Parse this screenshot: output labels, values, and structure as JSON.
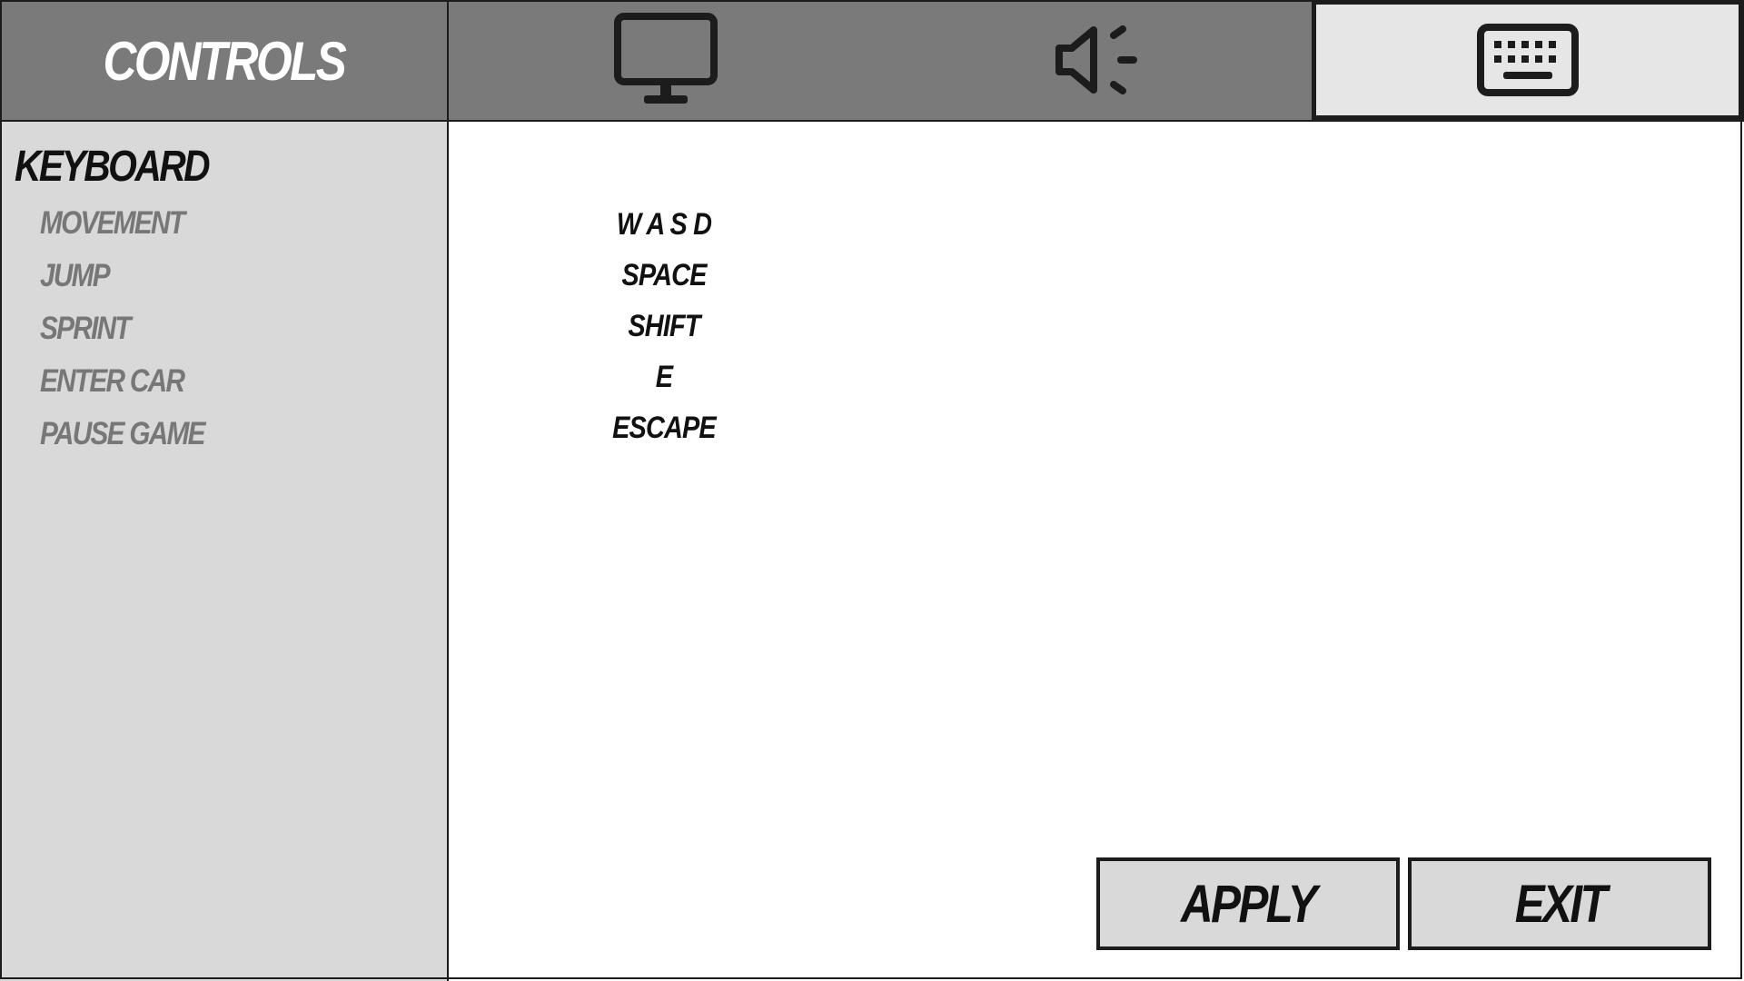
{
  "header": {
    "title": "CONTROLS",
    "tabs": [
      {
        "icon": "monitor-icon",
        "name": "display"
      },
      {
        "icon": "speaker-icon",
        "name": "audio"
      },
      {
        "icon": "keyboard-icon",
        "name": "controls",
        "active": true
      }
    ]
  },
  "sidebar": {
    "section": "KEYBOARD",
    "actions": [
      "MOVEMENT",
      "JUMP",
      "SPRINT",
      "ENTER CAR",
      "PAUSE GAME"
    ]
  },
  "bindings": [
    "W A S D",
    "SPACE",
    "SHIFT",
    "E",
    "ESCAPE"
  ],
  "buttons": {
    "apply": "APPLY",
    "exit": "EXIT"
  },
  "colors": {
    "header_bg": "#7a7a7a",
    "sidebar_bg": "#d9d9d9",
    "active_tab_bg": "#e6e6e6",
    "action_text": "#777777"
  }
}
